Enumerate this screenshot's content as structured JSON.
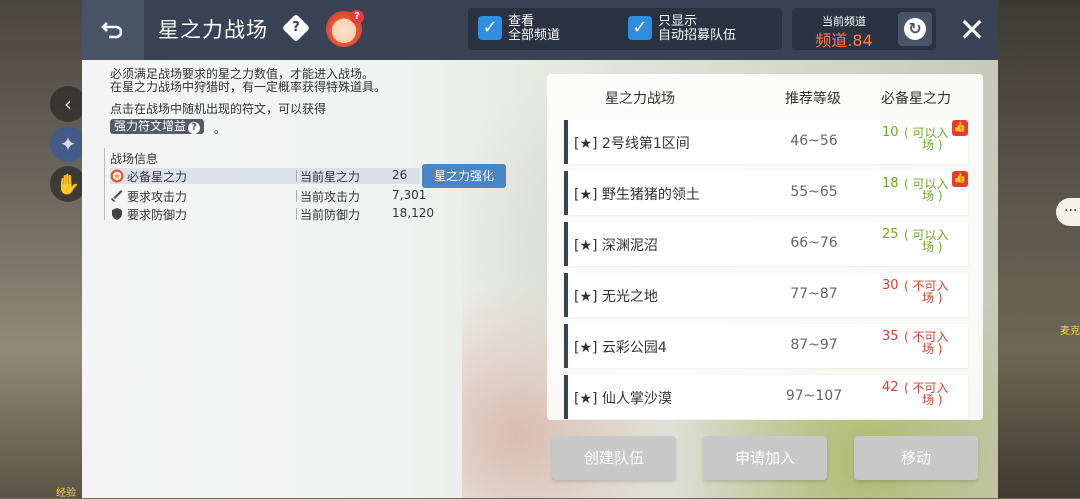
{
  "header": {
    "title": "星之力战场",
    "help_icon": "help-diamond-icon",
    "help_glyph": "?",
    "mascot_badge": "?",
    "filters": [
      {
        "label_line1": "查看",
        "label_line2": "全部频道",
        "checked": true
      },
      {
        "label_line1": "只显示",
        "label_line2": "自动招募队伍",
        "checked": true
      }
    ],
    "channel": {
      "caption": "当前频道",
      "value": "频道.84"
    },
    "refresh_icon": "refresh-icon",
    "close_icon": "close-icon",
    "back_icon": "back-arrow-icon"
  },
  "description": {
    "line1": "必须满足战场要求的星之力数值，才能进入战场。",
    "line2": "在星之力战场中狩猎时，有一定概率获得特殊道具。",
    "line3": "点击在战场中随机出现的符文，可以获得",
    "buff_label": "强力符文增益",
    "buff_suffix": "。"
  },
  "battle_info": {
    "title": "战场信息",
    "rows": [
      {
        "name": "必备星之力",
        "label": "当前星之力",
        "value": "26"
      },
      {
        "name": "要求攻击力",
        "label": "当前攻击力",
        "value": "7,301"
      },
      {
        "name": "要求防御力",
        "label": "当前防御力",
        "value": "18,120"
      }
    ],
    "enhance_button": "星之力强化"
  },
  "list": {
    "headers": {
      "name": "星之力战场",
      "level": "推荐等级",
      "star": "必备星之力"
    },
    "rows": [
      {
        "name": "[★]  2号线第1区间",
        "level": "46~56",
        "req": "10",
        "status1": "( 可以入",
        "status2": "场 )",
        "ok": true,
        "liked": true
      },
      {
        "name": "[★]  野生猪猪的领土",
        "level": "55~65",
        "req": "18",
        "status1": "( 可以入",
        "status2": "场 )",
        "ok": true,
        "liked": true
      },
      {
        "name": "[★]  深渊泥沼",
        "level": "66~76",
        "req": "25",
        "status1": "( 可以入",
        "status2": "场 )",
        "ok": true,
        "liked": false
      },
      {
        "name": "[★]  无光之地",
        "level": "77~87",
        "req": "30",
        "status1": "( 不可入",
        "status2": "场 )",
        "ok": false,
        "liked": false
      },
      {
        "name": "[★]  云彩公园4",
        "level": "87~97",
        "req": "35",
        "status1": "( 不可入",
        "status2": "场 )",
        "ok": false,
        "liked": false
      },
      {
        "name": "[★]  仙人掌沙漠",
        "level": "97~107",
        "req": "42",
        "status1": "( 不可入",
        "status2": "场 )",
        "ok": false,
        "liked": false
      }
    ]
  },
  "buttons": {
    "create": "创建队伍",
    "apply": "申请加入",
    "move": "移动"
  },
  "side": {
    "speech": "···",
    "bottom_left_tag": "经验",
    "right_tag": "麦克"
  }
}
